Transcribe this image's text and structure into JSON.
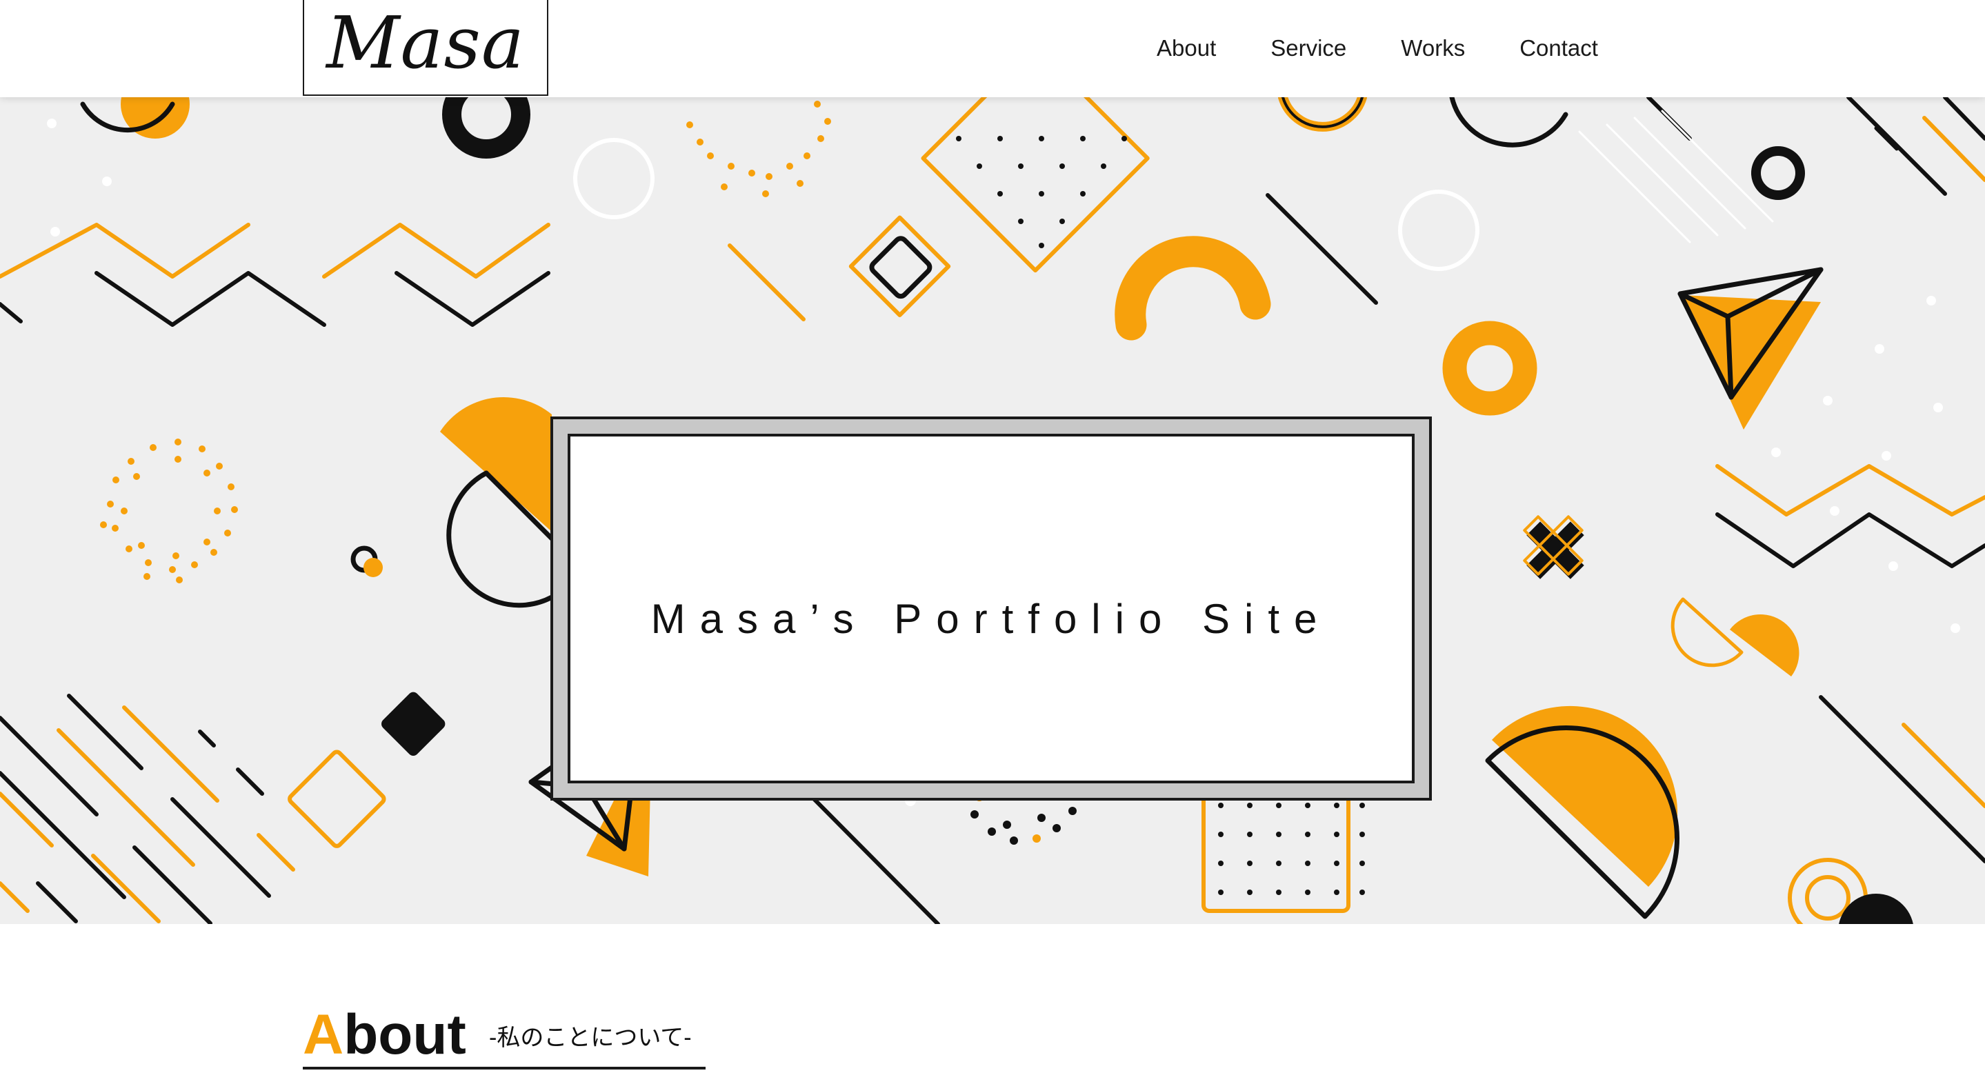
{
  "header": {
    "logo": "Masa",
    "nav": [
      "About",
      "Service",
      "Works",
      "Contact"
    ]
  },
  "hero": {
    "title": "Masa’s Portfolio Site"
  },
  "about": {
    "title_accent": "A",
    "title_rest": "bout",
    "subtitle": "-私のことについて-"
  },
  "colors": {
    "accent": "#f7a10c",
    "dark": "#1a1a1a",
    "hero_bg": "#efefef"
  }
}
